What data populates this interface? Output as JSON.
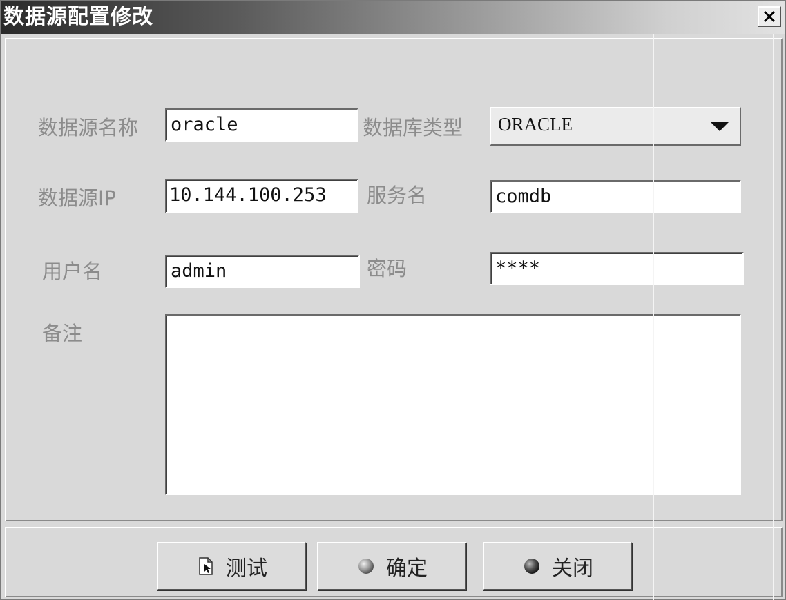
{
  "window": {
    "title": "数据源配置修改",
    "close_label": "X"
  },
  "form": {
    "ds_name_label": "数据源名称",
    "ds_name_value": "oracle",
    "db_type_label": "数据库类型",
    "db_type_value": "ORACLE",
    "ds_ip_label": "数据源IP",
    "ds_ip_value": "10.144.100.253",
    "service_label": "服务名",
    "service_value": "comdb",
    "user_label": "用户名",
    "user_value": "admin",
    "password_label": "密码",
    "password_value": "****",
    "remark_label": "备注",
    "remark_value": ""
  },
  "buttons": {
    "test_label": "测试",
    "confirm_label": "确定",
    "close_label": "关闭"
  },
  "icons": {
    "close": "close-icon",
    "test": "document-cursor-icon",
    "confirm": "gray-sphere-icon",
    "close_button": "dark-sphere-icon",
    "dropdown": "dropdown-arrow-icon"
  },
  "colors": {
    "label": "#8c8c8c",
    "panel": "#d9d9d9",
    "title_text": "#ffffff"
  }
}
